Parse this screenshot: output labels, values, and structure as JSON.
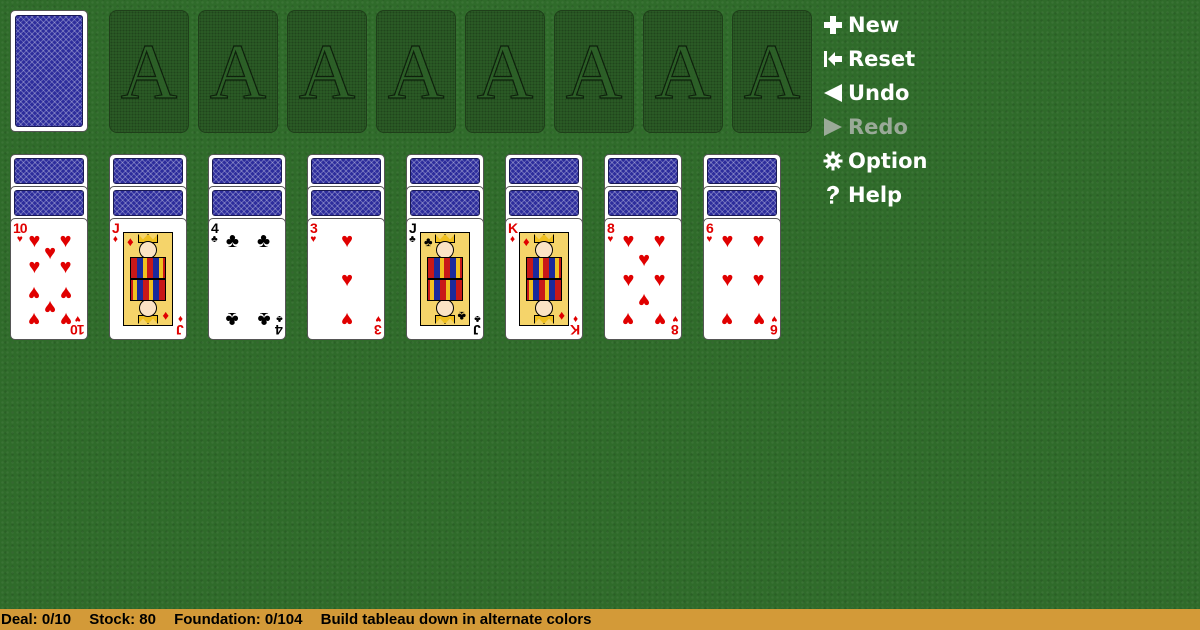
{
  "stock": {
    "cards_remaining": 80
  },
  "foundations": [
    {
      "label": "A"
    },
    {
      "label": "A"
    },
    {
      "label": "A"
    },
    {
      "label": "A"
    },
    {
      "label": "A"
    },
    {
      "label": "A"
    },
    {
      "label": "A"
    },
    {
      "label": "A"
    }
  ],
  "tableau": [
    {
      "face_down": 2,
      "rank": "10",
      "suit": "hearts",
      "color": "red"
    },
    {
      "face_down": 2,
      "rank": "J",
      "suit": "diamonds",
      "color": "red"
    },
    {
      "face_down": 2,
      "rank": "4",
      "suit": "clubs",
      "color": "black"
    },
    {
      "face_down": 2,
      "rank": "3",
      "suit": "hearts",
      "color": "red"
    },
    {
      "face_down": 2,
      "rank": "J",
      "suit": "clubs",
      "color": "black"
    },
    {
      "face_down": 2,
      "rank": "K",
      "suit": "diamonds",
      "color": "red"
    },
    {
      "face_down": 2,
      "rank": "8",
      "suit": "hearts",
      "color": "red"
    },
    {
      "face_down": 2,
      "rank": "6",
      "suit": "hearts",
      "color": "red"
    }
  ],
  "suit_glyphs": {
    "hearts": "♥",
    "diamonds": "♦",
    "clubs": "♣",
    "spades": "♠"
  },
  "menu": {
    "new": {
      "label": "New",
      "icon": "plus-icon"
    },
    "reset": {
      "label": "Reset",
      "icon": "reset-icon"
    },
    "undo": {
      "label": "Undo",
      "icon": "undo-icon"
    },
    "redo": {
      "label": "Redo",
      "icon": "redo-icon",
      "disabled": true
    },
    "option": {
      "label": "Option",
      "icon": "gear-icon"
    },
    "help": {
      "label": "Help",
      "icon": "help-icon"
    }
  },
  "status": {
    "deal": "Deal: 0/10",
    "stock": "Stock: 80",
    "foundation": "Foundation: 0/104",
    "hint": "Build tableau down in alternate colors"
  },
  "colors": {
    "felt": "#2f6b2a",
    "card_back": "#2d2d9c",
    "red_suit": "#e00000",
    "status_bar": "#d39a38",
    "menu_text": "#ffffff",
    "menu_disabled": "#9aaa98"
  }
}
